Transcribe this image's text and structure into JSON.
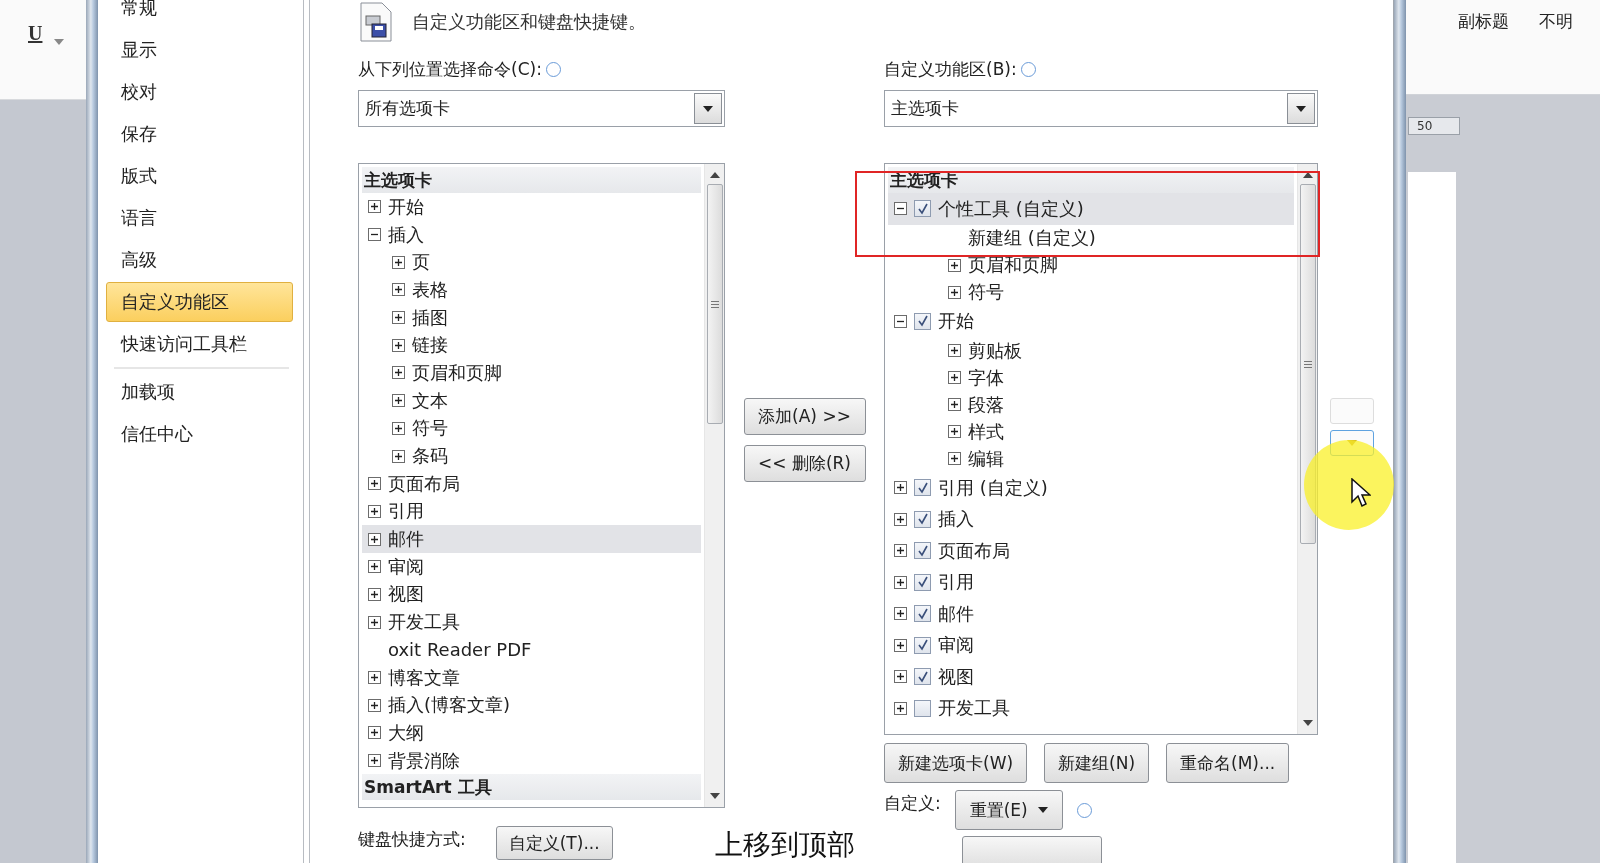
{
  "document": {
    "format_buttons": [
      "U"
    ],
    "style_gallery": [
      "副标题",
      "不明"
    ],
    "ruler_value": "50"
  },
  "sidebar": {
    "items": [
      {
        "label": "常规",
        "selected": false,
        "divider_before": false
      },
      {
        "label": "显示",
        "selected": false,
        "divider_before": false
      },
      {
        "label": "校对",
        "selected": false,
        "divider_before": false
      },
      {
        "label": "保存",
        "selected": false,
        "divider_before": false
      },
      {
        "label": "版式",
        "selected": false,
        "divider_before": false
      },
      {
        "label": "语言",
        "selected": false,
        "divider_before": false
      },
      {
        "label": "高级",
        "selected": false,
        "divider_before": false
      },
      {
        "label": "自定义功能区",
        "selected": true,
        "divider_before": false
      },
      {
        "label": "快速访问工具栏",
        "selected": false,
        "divider_before": false
      },
      {
        "label": "加载项",
        "selected": false,
        "divider_before": true
      },
      {
        "label": "信任中心",
        "selected": false,
        "divider_before": false
      }
    ]
  },
  "heading": {
    "text": "自定义功能区和键盘快捷键。"
  },
  "commands": {
    "label": "从下列位置选择命令(C):",
    "dropdown": "所有选项卡",
    "list": {
      "header": "主选项卡",
      "items": [
        {
          "label": "开始",
          "expandable": true,
          "expanded": false,
          "selected": false
        },
        {
          "label": "插入",
          "expandable": true,
          "expanded": true,
          "selected": false,
          "children": [
            {
              "label": "页",
              "expandable": true,
              "expanded": false,
              "selected": false
            },
            {
              "label": "表格",
              "expandable": true,
              "expanded": false,
              "selected": false
            },
            {
              "label": "插图",
              "expandable": true,
              "expanded": false,
              "selected": false
            },
            {
              "label": "链接",
              "expandable": true,
              "expanded": false,
              "selected": false
            },
            {
              "label": "页眉和页脚",
              "expandable": true,
              "expanded": false,
              "selected": false
            },
            {
              "label": "文本",
              "expandable": true,
              "expanded": false,
              "selected": false
            },
            {
              "label": "符号",
              "expandable": true,
              "expanded": false,
              "selected": false
            },
            {
              "label": "条码",
              "expandable": true,
              "expanded": false,
              "selected": false
            }
          ]
        },
        {
          "label": "页面布局",
          "expandable": true,
          "expanded": false,
          "selected": false
        },
        {
          "label": "引用",
          "expandable": true,
          "expanded": false,
          "selected": false
        },
        {
          "label": "邮件",
          "expandable": true,
          "expanded": false,
          "selected": true
        },
        {
          "label": "审阅",
          "expandable": true,
          "expanded": false,
          "selected": false
        },
        {
          "label": "视图",
          "expandable": true,
          "expanded": false,
          "selected": false
        },
        {
          "label": "开发工具",
          "expandable": true,
          "expanded": false,
          "selected": false
        },
        {
          "label": "oxit Reader PDF",
          "expandable": false,
          "selected": false
        },
        {
          "label": "博客文章",
          "expandable": true,
          "expanded": false,
          "selected": false
        },
        {
          "label": "插入(博客文章)",
          "expandable": true,
          "expanded": false,
          "selected": false
        },
        {
          "label": "大纲",
          "expandable": true,
          "expanded": false,
          "selected": false
        },
        {
          "label": "背景消除",
          "expandable": true,
          "expanded": false,
          "selected": false
        }
      ],
      "footer_header": "SmartArt 工具"
    },
    "shortcuts": {
      "label": "键盘快捷方式:",
      "button": "自定义(T)..."
    }
  },
  "transfer_buttons": [
    "添加(A) >>",
    "<< 删除(R)"
  ],
  "ribbon": {
    "label": "自定义功能区(B):",
    "dropdown": "主选项卡",
    "list": {
      "header": "主选项卡",
      "items": [
        {
          "label": "个性工具 (自定义)",
          "expandable": true,
          "expanded": true,
          "checked": true,
          "selected": true,
          "children": [
            {
              "label": "新建组 (自定义)",
              "expandable": false,
              "selected": false
            },
            {
              "label": "页眉和页脚",
              "expandable": true,
              "expanded": false,
              "selected": false
            },
            {
              "label": "符号",
              "expandable": true,
              "expanded": false,
              "selected": false
            }
          ]
        },
        {
          "label": "开始",
          "expandable": true,
          "expanded": true,
          "checked": true,
          "selected": false,
          "children": [
            {
              "label": "剪贴板",
              "expandable": true,
              "expanded": false,
              "selected": false
            },
            {
              "label": "字体",
              "expandable": true,
              "expanded": false,
              "selected": false
            },
            {
              "label": "段落",
              "expandable": true,
              "expanded": false,
              "selected": false
            },
            {
              "label": "样式",
              "expandable": true,
              "expanded": false,
              "selected": false
            },
            {
              "label": "编辑",
              "expandable": true,
              "expanded": false,
              "selected": false
            }
          ]
        },
        {
          "label": "引用 (自定义)",
          "expandable": true,
          "expanded": false,
          "checked": true,
          "selected": false
        },
        {
          "label": "插入",
          "expandable": true,
          "expanded": false,
          "checked": true,
          "selected": false
        },
        {
          "label": "页面布局",
          "expandable": true,
          "expanded": false,
          "checked": true,
          "selected": false
        },
        {
          "label": "引用",
          "expandable": true,
          "expanded": false,
          "checked": true,
          "selected": false
        },
        {
          "label": "邮件",
          "expandable": true,
          "expanded": false,
          "checked": true,
          "selected": false
        },
        {
          "label": "审阅",
          "expandable": true,
          "expanded": false,
          "checked": true,
          "selected": false
        },
        {
          "label": "视图",
          "expandable": true,
          "expanded": false,
          "checked": true,
          "selected": false
        },
        {
          "label": "开发工具",
          "expandable": true,
          "expanded": false,
          "checked": false,
          "selected": false
        }
      ]
    },
    "buttons": [
      "新建选项卡(W)",
      "新建组(N)",
      "重命名(M)..."
    ],
    "customize": {
      "label": "自定义:",
      "button": "重置(E)"
    }
  },
  "caption": "上移到顶部"
}
